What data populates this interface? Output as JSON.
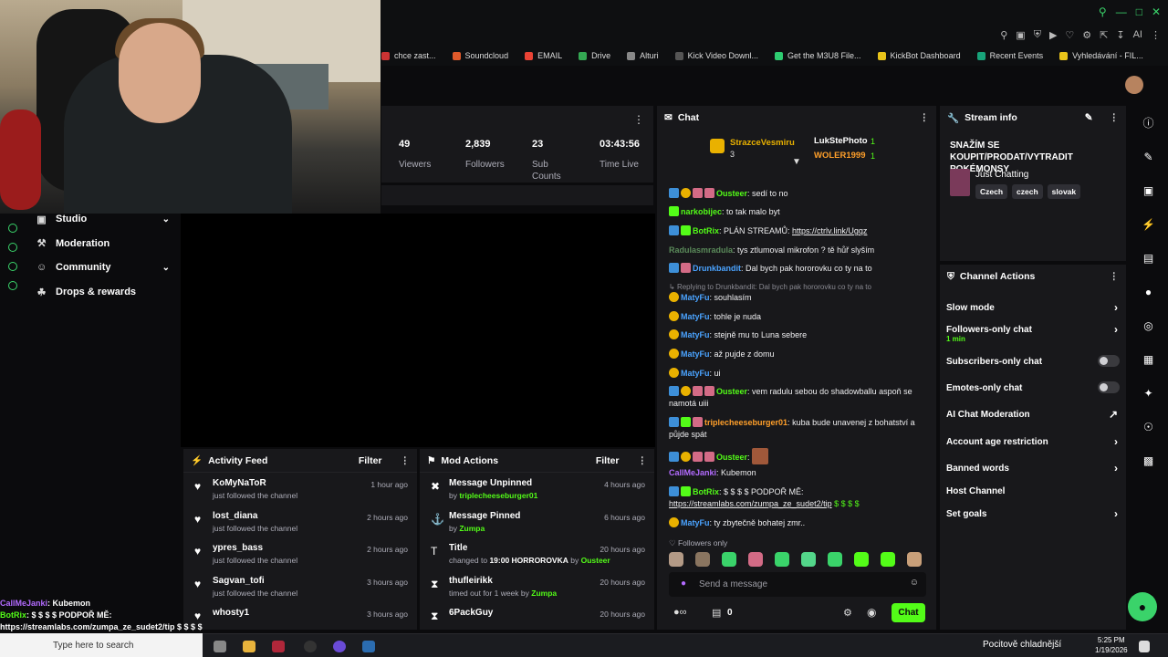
{
  "bookmarks": [
    "chce zast...",
    "Soundcloud",
    "EMAIL",
    "Drive",
    "Alturi",
    "Kick Video Downl...",
    "Get the M3U8 File...",
    "KickBot Dashboard",
    "Recent Events",
    "Vyhledávání - FIL..."
  ],
  "browser": {
    "ai_label": "AI"
  },
  "sidebar": {
    "items": [
      {
        "label": "Studio",
        "icon": "studio-icon",
        "chevron": true
      },
      {
        "label": "Moderation",
        "icon": "wrench-icon",
        "chevron": false
      },
      {
        "label": "Community",
        "icon": "people-icon",
        "chevron": true
      },
      {
        "label": "Drops & rewards",
        "icon": "gift-icon",
        "chevron": false
      }
    ]
  },
  "stats": [
    {
      "value": "49",
      "label": "Viewers"
    },
    {
      "value": "2,839",
      "label": "Followers"
    },
    {
      "value": "23",
      "label": "Sub Counts"
    },
    {
      "value": "03:43:56",
      "label": "Time Live"
    }
  ],
  "activity": {
    "title": "Activity Feed",
    "filter": "Filter",
    "rows": [
      {
        "user": "KoMyNaToR",
        "sub": "just followed the channel",
        "time": "1 hour ago"
      },
      {
        "user": "lost_diana",
        "sub": "just followed the channel",
        "time": "2 hours ago"
      },
      {
        "user": "ypres_bass",
        "sub": "just followed the channel",
        "time": "2 hours ago"
      },
      {
        "user": "Sagvan_tofi",
        "sub": "just followed the channel",
        "time": "3 hours ago"
      },
      {
        "user": "whosty1",
        "sub": "",
        "time": "3 hours ago"
      }
    ]
  },
  "mod": {
    "title": "Mod Actions",
    "filter": "Filter",
    "rows": [
      {
        "title": "Message Unpinned",
        "pre": "by ",
        "who": "triplecheeseburger01",
        "mid": "",
        "extra": "",
        "post": "",
        "who2": "",
        "time": "4 hours ago",
        "icon": "unpin-icon"
      },
      {
        "title": "Message Pinned",
        "pre": "by ",
        "who": "Zumpa",
        "mid": "",
        "extra": "",
        "post": "",
        "who2": "",
        "time": "6 hours ago",
        "icon": "pin-icon"
      },
      {
        "title": "Title",
        "pre": "changed to ",
        "who": "",
        "mid": "",
        "extra": "19:00 HORROROVKA",
        "post": " by ",
        "who2": "Ousteer",
        "time": "20 hours ago",
        "icon": "title-icon"
      },
      {
        "title": "thufleirikk",
        "pre": "timed out for 1 week by ",
        "who": "Zumpa",
        "mid": "",
        "extra": "",
        "post": "",
        "who2": "",
        "time": "20 hours ago",
        "icon": "hourglass-icon"
      },
      {
        "title": "6PackGuy",
        "pre": "",
        "who": "",
        "mid": "",
        "extra": "",
        "post": "",
        "who2": "",
        "time": "20 hours ago",
        "icon": "hourglass-icon"
      }
    ]
  },
  "chat": {
    "title": "Chat",
    "leaders": {
      "first": "StrazceVesmiru",
      "first_count": "3",
      "second": "LukStePhoto",
      "second_count": "1",
      "third": "WOLER1999",
      "third_count": "1"
    },
    "messages": [
      {
        "user": "Ousteer",
        "color": "#53fc18",
        "text": "sedí to no"
      },
      {
        "user": "narkobijec",
        "color": "#53fc18",
        "text": "to tak malo byt"
      },
      {
        "user": "BotRix",
        "color": "#53fc18",
        "text": "PLÁN STREAMŮ: ",
        "link": "https://ctrlv.link/Ugqz"
      },
      {
        "user": "Radulasmradula",
        "color": "#5a8a5a",
        "text": "tys ztlumoval mikrofon ? tě hůř slyším"
      },
      {
        "user": "Drunkbandit",
        "color": "#4aa3ff",
        "text": "Dal bych pak hororovku co ty na to"
      },
      {
        "reply": "Replying to Drunkbandit: Dal bych pak hororovku co ty na to"
      },
      {
        "user": "MatyFu",
        "color": "#4aa3ff",
        "text": "souhlasím"
      },
      {
        "user": "MatyFu",
        "color": "#4aa3ff",
        "text": "tohle je nuda"
      },
      {
        "user": "MatyFu",
        "color": "#4aa3ff",
        "text": "stejně mu to Luna sebere"
      },
      {
        "user": "MatyFu",
        "color": "#4aa3ff",
        "text": "až pujde z domu"
      },
      {
        "user": "MatyFu",
        "color": "#4aa3ff",
        "text": "ui"
      },
      {
        "user": "Ousteer",
        "color": "#53fc18",
        "text": "vem radulu sebou do shadowballu aspoň se namotá uiii"
      },
      {
        "user": "triplecheeseburger01",
        "color": "#ff9f2a",
        "text": "kuba bude unavenej z bohatství a půjde spát"
      },
      {
        "user": "Ousteer",
        "color": "#53fc18",
        "text": ""
      },
      {
        "user": "CallMeJanki",
        "color": "#b36bff",
        "text": "Kubemon"
      },
      {
        "user": "BotRix",
        "color": "#53fc18",
        "text": "$ $ $ $ PODPOŘ MĚ: ",
        "link": "https://streamlabs.com/zumpa_ze_sudet2/tip",
        "after": " $ $ $ $"
      },
      {
        "user": "MatyFu",
        "color": "#4aa3ff",
        "text": "ty zbytečně bohatej zmr.."
      }
    ],
    "followers_only": "Followers only",
    "send_placeholder": "Send a message",
    "points": "0",
    "chat_button": "Chat"
  },
  "stream_info": {
    "title": "Stream info",
    "stream_title": "SNAŽÍM SE KOUPIT/PRODAT/VYTRADIT POKÉMONSY",
    "category": "Just Chatting",
    "tags": [
      "Czech",
      "czech",
      "slovak"
    ]
  },
  "channel_actions": {
    "title": "Channel Actions",
    "rows": [
      {
        "label": "Slow mode",
        "kind": "chevron",
        "sub": ""
      },
      {
        "label": "Followers-only chat",
        "kind": "chevron",
        "sub": "1 min"
      },
      {
        "label": "Subscribers-only chat",
        "kind": "toggle",
        "sub": ""
      },
      {
        "label": "Emotes-only chat",
        "kind": "toggle",
        "sub": ""
      },
      {
        "label": "AI Chat Moderation",
        "kind": "external",
        "sub": ""
      },
      {
        "label": "Account age restriction",
        "kind": "chevron",
        "sub": ""
      },
      {
        "label": "Banned words",
        "kind": "chevron",
        "sub": ""
      },
      {
        "label": "Host Channel",
        "kind": "none",
        "sub": ""
      },
      {
        "label": "Set goals",
        "kind": "chevron",
        "sub": ""
      }
    ]
  },
  "overlay": {
    "l1_user": "CallMeJanki",
    "l1_text": "Kubemon",
    "l2_user": "BotRix",
    "l2_text": "$ $ $ $ PODPOŘ MĚ:",
    "l3": "https://streamlabs.com/zumpa_ze_sudet2/tip $ $ $ $"
  },
  "taskbar": {
    "search_placeholder": "Type here to search",
    "weather": "Pocitově chladnější",
    "time": "5:25 PM",
    "date": "1/19/2026"
  },
  "colors": {
    "accent": "#53fc18",
    "panel": "#18181b",
    "bg": "#0b0b0d"
  }
}
